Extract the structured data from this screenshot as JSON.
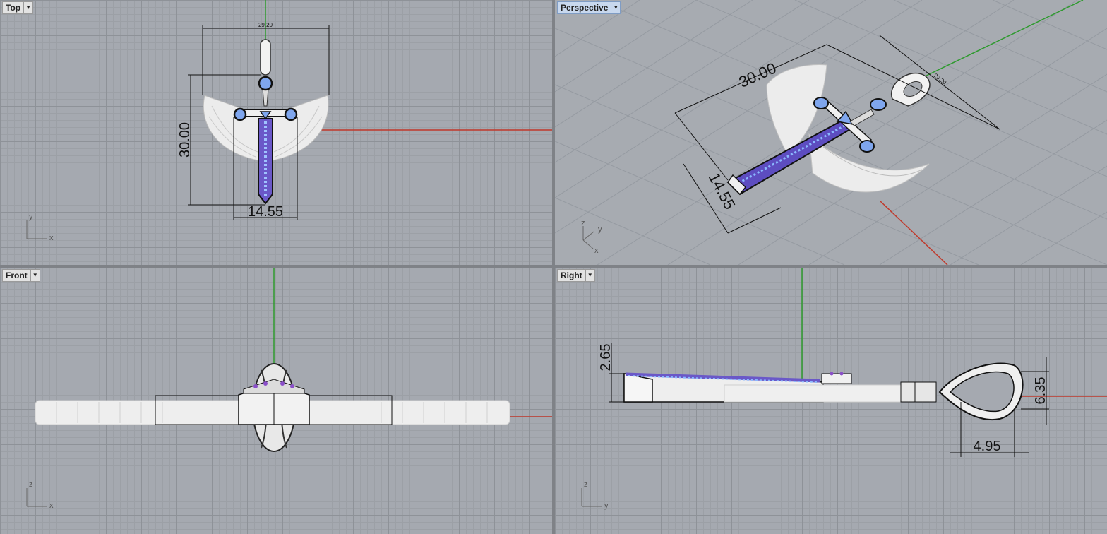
{
  "viewports": {
    "top": {
      "name": "Top"
    },
    "perspective": {
      "name": "Perspective"
    },
    "front": {
      "name": "Front"
    },
    "right": {
      "name": "Right"
    }
  },
  "dimensions": {
    "top_width": "29.20",
    "top_height": "30.00",
    "top_bottom": "14.55",
    "persp_length": "30.00",
    "persp_width": "14.55",
    "persp_small": "29.20",
    "right_height": "2.65",
    "right_bail": "6.35",
    "right_bail_width": "4.95"
  },
  "axes": {
    "top": [
      "y",
      "x"
    ],
    "persp": [
      "z",
      "y",
      "x"
    ],
    "front": [
      "z",
      "x"
    ],
    "right": [
      "z",
      "y"
    ]
  },
  "colors": {
    "grid_bg": "#a5a9b0",
    "x_axis": "#c0392b",
    "y_axis": "#2e9a2e",
    "gem": "#7fa6ee",
    "gem_purple": "#8a4fc9",
    "metal": "#e9e9e9"
  }
}
